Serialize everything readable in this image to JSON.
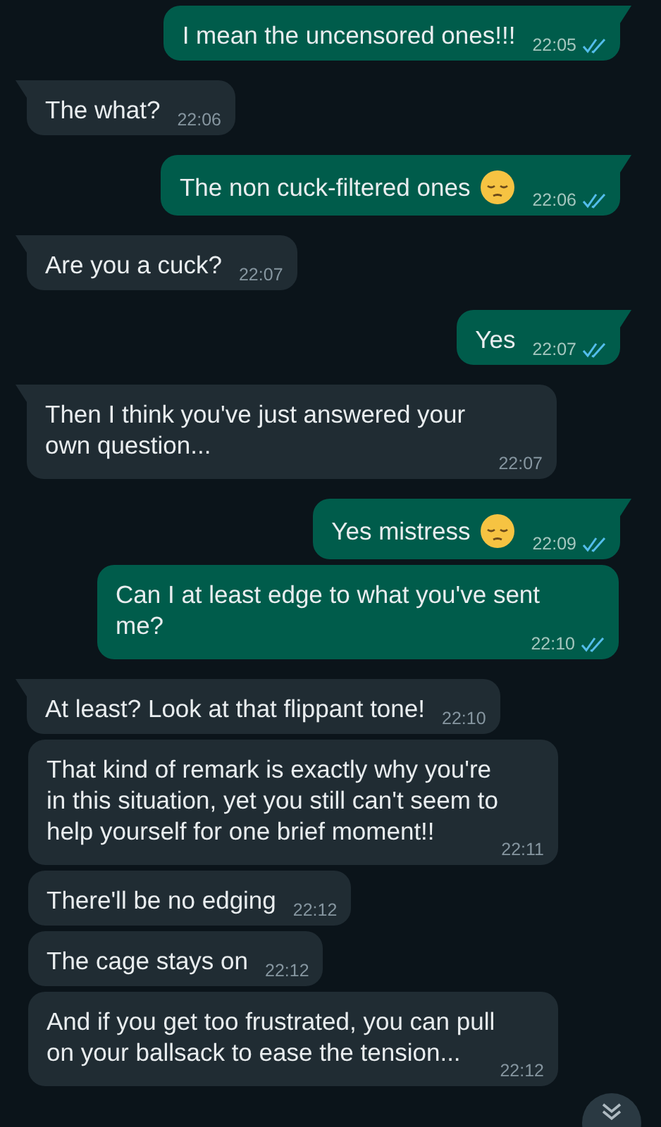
{
  "messages": [
    {
      "kind": "sent",
      "text": "I mean the uncensored ones!!!",
      "time": "22:05",
      "read": true,
      "tail": true
    },
    {
      "kind": "received",
      "text": "The what?",
      "time": "22:06",
      "tail": true
    },
    {
      "kind": "sent",
      "text": "The non cuck-filtered ones",
      "pensive_emoji": true,
      "time": "22:06",
      "read": true,
      "tail": true
    },
    {
      "kind": "received",
      "text": "Are you a cuck?",
      "time": "22:07",
      "tail": true
    },
    {
      "kind": "sent",
      "text": "Yes",
      "time": "22:07",
      "read": true,
      "tail": true
    },
    {
      "kind": "received",
      "text": "Then I think you've just answered your own question...",
      "time": "22:07",
      "tail": true
    },
    {
      "kind": "sent",
      "text": "Yes mistress",
      "pensive_emoji": true,
      "time": "22:09",
      "read": true,
      "tail": true
    },
    {
      "kind": "sent",
      "text": "Can I at least edge to what you've sent me?",
      "time": "22:10",
      "read": true,
      "tail": false
    },
    {
      "kind": "received",
      "text": "At least? Look at that flippant tone!",
      "time": "22:10",
      "tail": true
    },
    {
      "kind": "received",
      "text": "That kind of remark is exactly why you're in this situation, yet you still can't seem to help yourself for one brief moment!!",
      "time": "22:11",
      "tail": false
    },
    {
      "kind": "received",
      "text": "There'll be no edging",
      "time": "22:12",
      "tail": false
    },
    {
      "kind": "received",
      "text": "The cage stays on",
      "time": "22:12",
      "tail": false
    },
    {
      "kind": "received",
      "text": "And if you get too frustrated, you can pull on your ballsack to ease the tension...",
      "time": "22:12",
      "tail": false
    }
  ]
}
